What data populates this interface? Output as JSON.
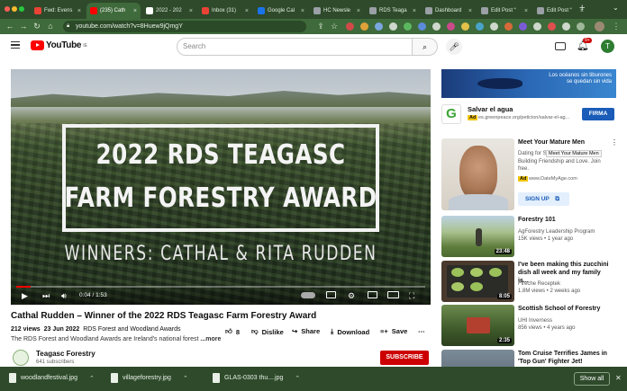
{
  "browser": {
    "tabs": [
      {
        "label": "Fwd: Evens",
        "color": "#ea4335"
      },
      {
        "label": "(235) Cath",
        "color": "#ff0000"
      },
      {
        "label": "2022 - 202",
        "color": "#ffffff"
      },
      {
        "label": "Inbox (31)",
        "color": "#ea4335"
      },
      {
        "label": "Google Cal",
        "color": "#1a73e8"
      },
      {
        "label": "HC Newsle",
        "color": "#9aa0a6"
      },
      {
        "label": "RDS Teaga",
        "color": "#9aa0a6"
      },
      {
        "label": "Dashboard",
        "color": "#9aa0a6"
      },
      {
        "label": "Edit Post “",
        "color": "#9aa0a6"
      },
      {
        "label": "Edit Post “",
        "color": "#9aa0a6"
      }
    ],
    "new_tab": "+",
    "url": "youtube.com/watch?v=8Huew9jQmgY",
    "profile_initial": "T"
  },
  "youtube": {
    "logo": "YouTube",
    "logo_region": "IE",
    "search_placeholder": "Search",
    "notifications": "9+",
    "avatar": "T"
  },
  "video": {
    "overlay_line1": "2022 RDS TEAGASC",
    "overlay_line2": "FARM FORESTRY AWARD",
    "overlay_winners": "WINNERS:  CATHAL & RITA RUDDEN",
    "time": "0:04 / 1:53",
    "progress_fraction": 0.035,
    "title": "Cathal Rudden – Winner of the 2022 RDS Teagasc Farm Forestry Award",
    "views": "212 views",
    "date": "23 Jun 2022",
    "tag": "RDS Forest and Woodland Awards",
    "desc": "The RDS Forest and Woodland Awards are Ireland's national forest",
    "more": "...more",
    "likes": "8",
    "dislike": "Dislike",
    "share": "Share",
    "download": "Download",
    "save": "Save",
    "channel": "Teagasc Forestry",
    "subscribers": "641 subscribers",
    "subscribe": "SUBSCRIBE"
  },
  "sidebar": {
    "ad_banner_text": "Los océanos sin tiburones\nse quedan sin vida",
    "ad": {
      "title": "Salvar el agua",
      "badge": "Ad",
      "url": "es.greenpeace.org/peticion/salvar-el-ag...",
      "cta": "FIRMA"
    },
    "sponsored": {
      "title": "Meet Your Mature Men",
      "line1": "Dating for S",
      "tooltip": "Meet Your Mature Men",
      "line2": "Building Friendship and Love. Join",
      "line3": "free.",
      "badge": "Ad",
      "url": "www.DateMyAge.com",
      "cta": "SIGN UP"
    },
    "videos": [
      {
        "title": "Forestry 101",
        "channel": "AgForestry Leadership Program",
        "meta": "15K views • 1 year ago",
        "duration": "23:48"
      },
      {
        "title": "I've been making this zucchini dish all week and my family is...",
        "channel": "Fireche Receptek",
        "meta": "1.8M views • 2 weeks ago",
        "duration": "8:05"
      },
      {
        "title": "Scottish School of Forestry",
        "channel": "UHI Inverness",
        "meta": "856 views • 4 years ago",
        "duration": "2:35"
      },
      {
        "title": "Tom Cruise Terrifies James in 'Top Gun' Fighter Jet!",
        "channel": "",
        "meta": "",
        "duration": ""
      }
    ]
  },
  "downloads": {
    "files": [
      "woodlandfestival.jpg",
      "villageforestry.jpg",
      "GLAS-0303 thu....jpg"
    ],
    "show_all": "Show all"
  }
}
